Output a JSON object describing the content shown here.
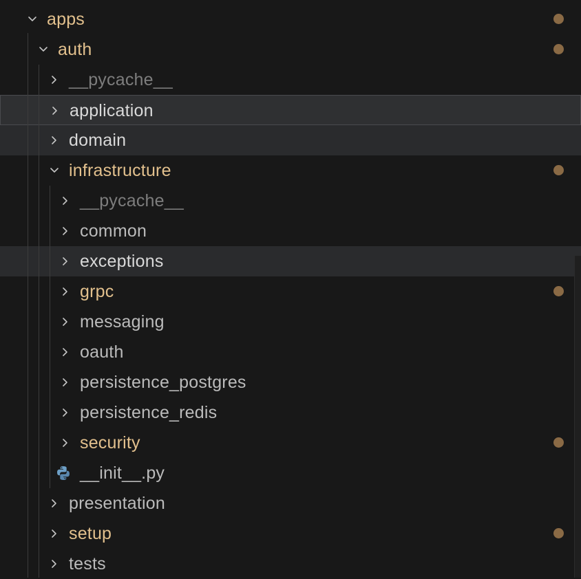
{
  "explorer": {
    "colors": {
      "modified": "#e2c08d",
      "normal": "#bbbbbb",
      "ignored": "#7d7d7d",
      "dot": "#8a6a45",
      "background": "#181818"
    },
    "items": [
      {
        "label": "apps",
        "level": 0,
        "type": "folder",
        "expanded": true,
        "status": "modified",
        "dot": true
      },
      {
        "label": "auth",
        "level": 1,
        "type": "folder",
        "expanded": true,
        "status": "modified",
        "dot": true
      },
      {
        "label": "__pycache__",
        "level": 2,
        "type": "folder",
        "expanded": false,
        "status": "ignored",
        "dot": false
      },
      {
        "label": "application",
        "level": 2,
        "type": "folder",
        "expanded": false,
        "status": "bright",
        "dot": false,
        "state": "selected"
      },
      {
        "label": "domain",
        "level": 2,
        "type": "folder",
        "expanded": false,
        "status": "bright",
        "dot": false,
        "state": "hover"
      },
      {
        "label": "infrastructure",
        "level": 2,
        "type": "folder",
        "expanded": true,
        "status": "modified",
        "dot": true
      },
      {
        "label": "__pycache__",
        "level": 3,
        "type": "folder",
        "expanded": false,
        "status": "ignored",
        "dot": false
      },
      {
        "label": "common",
        "level": 3,
        "type": "folder",
        "expanded": false,
        "status": "normal",
        "dot": false
      },
      {
        "label": "exceptions",
        "level": 3,
        "type": "folder",
        "expanded": false,
        "status": "bright",
        "dot": false,
        "state": "hover"
      },
      {
        "label": "grpc",
        "level": 3,
        "type": "folder",
        "expanded": false,
        "status": "modified",
        "dot": true
      },
      {
        "label": "messaging",
        "level": 3,
        "type": "folder",
        "expanded": false,
        "status": "normal",
        "dot": false
      },
      {
        "label": "oauth",
        "level": 3,
        "type": "folder",
        "expanded": false,
        "status": "normal",
        "dot": false
      },
      {
        "label": "persistence_postgres",
        "level": 3,
        "type": "folder",
        "expanded": false,
        "status": "normal",
        "dot": false
      },
      {
        "label": "persistence_redis",
        "level": 3,
        "type": "folder",
        "expanded": false,
        "status": "normal",
        "dot": false
      },
      {
        "label": "security",
        "level": 3,
        "type": "folder",
        "expanded": false,
        "status": "modified",
        "dot": true
      },
      {
        "label": "__init__.py",
        "level": 3,
        "type": "file",
        "icon": "python-icon",
        "status": "normal",
        "dot": false
      },
      {
        "label": "presentation",
        "level": 2,
        "type": "folder",
        "expanded": false,
        "status": "normal",
        "dot": false
      },
      {
        "label": "setup",
        "level": 2,
        "type": "folder",
        "expanded": false,
        "status": "modified",
        "dot": true
      },
      {
        "label": "tests",
        "level": 2,
        "type": "folder",
        "expanded": false,
        "status": "normal",
        "dot": false
      }
    ]
  }
}
